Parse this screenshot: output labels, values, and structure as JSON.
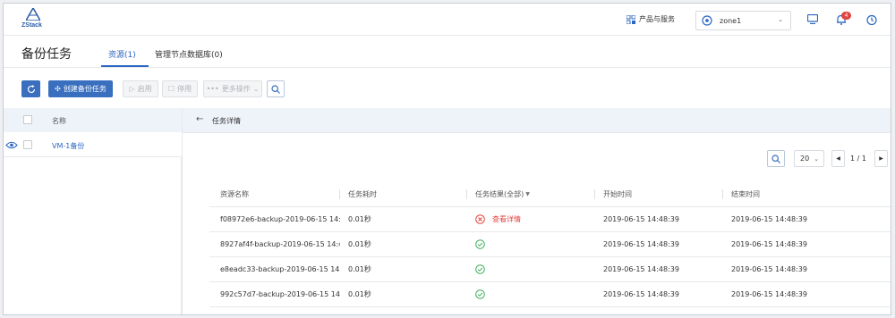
{
  "app": {
    "logo_text": "ZStack"
  },
  "topbar": {
    "products_label": "产品与服务",
    "zone_value": "zone1",
    "notification_count": "4"
  },
  "page": {
    "title": "备份任务",
    "tabs": [
      {
        "label": "资源(1)",
        "active": true
      },
      {
        "label": "管理节点数据库(0)",
        "active": false
      }
    ]
  },
  "toolbar": {
    "create_label": "创建备份任务",
    "enable_label": "启用",
    "disable_label": "停用",
    "more_label": "更多操作"
  },
  "left_list": {
    "header_name": "名称",
    "items": [
      {
        "name": "VM-1备份"
      }
    ]
  },
  "detail": {
    "title": "任务详情",
    "page_size": "20",
    "pagination": "1 / 1",
    "columns": [
      "资源名称",
      "任务耗时",
      "任务结果(全部)",
      "开始时间",
      "结束时间"
    ],
    "rows": [
      {
        "name": "f08972e6-backup-2019-06-15 14:4...",
        "duration": "0.01秒",
        "result": "failed",
        "result_link": "查看详情",
        "start": "2019-06-15 14:48:39",
        "end": "2019-06-15 14:48:39"
      },
      {
        "name": "8927af4f-backup-2019-06-15 14:4...",
        "duration": "0.01秒",
        "result": "success",
        "result_link": "",
        "start": "2019-06-15 14:48:39",
        "end": "2019-06-15 14:48:39"
      },
      {
        "name": "e8eadc33-backup-2019-06-15 14:...",
        "duration": "0.01秒",
        "result": "success",
        "result_link": "",
        "start": "2019-06-15 14:48:39",
        "end": "2019-06-15 14:48:39"
      },
      {
        "name": "992c57d7-backup-2019-06-15 14:...",
        "duration": "0.01秒",
        "result": "success",
        "result_link": "",
        "start": "2019-06-15 14:48:39",
        "end": "2019-06-15 14:48:39"
      }
    ]
  },
  "colors": {
    "accent": "#2a66c2",
    "primary_button": "#3a6fbf",
    "success": "#3fae5a",
    "error": "#e0443f",
    "header_bg": "#eef3fa"
  }
}
